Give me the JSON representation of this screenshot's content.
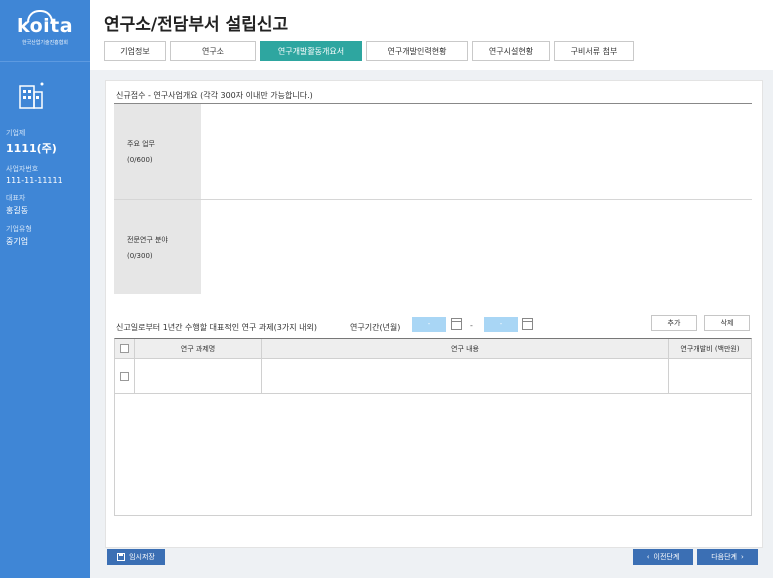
{
  "app": {
    "logo_text": "koita",
    "logo_subtext": "한국산업기술진흥협회"
  },
  "sidebar": {
    "company_label": "기업제",
    "company_value": "1111(주)",
    "biz_no_label": "사업자번호",
    "biz_no_value": "111-11-11111",
    "ceo_label": "대표자",
    "ceo_value": "홍길동",
    "type_label": "기업유형",
    "type_value": "중기업"
  },
  "header": {
    "title": "연구소/전담부서 설립신고",
    "tabs": [
      {
        "label": "기업정보",
        "active": false
      },
      {
        "label": "연구소",
        "active": false
      },
      {
        "label": "연구개발활동개요서",
        "active": true
      },
      {
        "label": "연구개발인력현황",
        "active": false
      },
      {
        "label": "연구시설현황",
        "active": false
      },
      {
        "label": "구비서류 첨부",
        "active": false
      }
    ]
  },
  "overview": {
    "section_title": "신규접수 - 연구사업개요 (각각 300자 이내만 가능합니다.)",
    "main_work_label": "주요 업무",
    "main_work_count": "(0/600)",
    "research_field_label": "전문연구 분야",
    "research_field_count": "(0/300)"
  },
  "projects": {
    "title": "신고일로부터 1년간 수행할 대표적인 연구 과제(3가지 내외)",
    "period_label": "연구기간(년월)",
    "start_value": "-",
    "end_value": "-",
    "range_separator": "-",
    "add_label": "추가",
    "delete_label": "삭제",
    "columns": [
      "연구 과제명",
      "연구 내용",
      "연구개발비 (백만원)"
    ]
  },
  "footer": {
    "temp_save_label": "임시저장",
    "prev_label": "이전단계",
    "next_label": "다음단계"
  },
  "colors": {
    "sidebar": "#3f86d6",
    "active_tab": "#2ea6a0",
    "primary_button": "#3b6fb4",
    "date_input": "#a9d6f5"
  }
}
